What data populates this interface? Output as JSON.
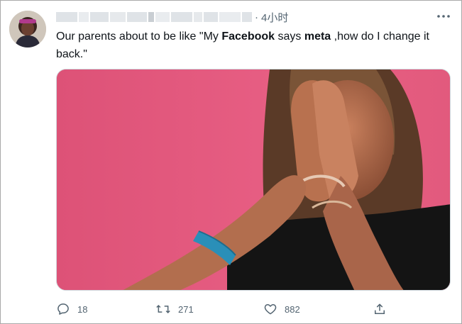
{
  "tweet": {
    "timestamp": "4小时",
    "separator": "·",
    "text": {
      "part1": "Our parents about to be like \"My ",
      "bold1": "Facebook",
      "part2": " says ",
      "bold2": "meta",
      "part3": " ,how do I change it back.\""
    }
  },
  "actions": {
    "reply_count": "18",
    "retweet_count": "271",
    "like_count": "882"
  },
  "icons": {
    "more": "more-icon",
    "reply": "reply-icon",
    "retweet": "retweet-icon",
    "like": "like-icon",
    "share": "share-icon"
  },
  "colors": {
    "text": "#0f1419",
    "secondary": "#536471",
    "media_background": "#e2577a"
  }
}
